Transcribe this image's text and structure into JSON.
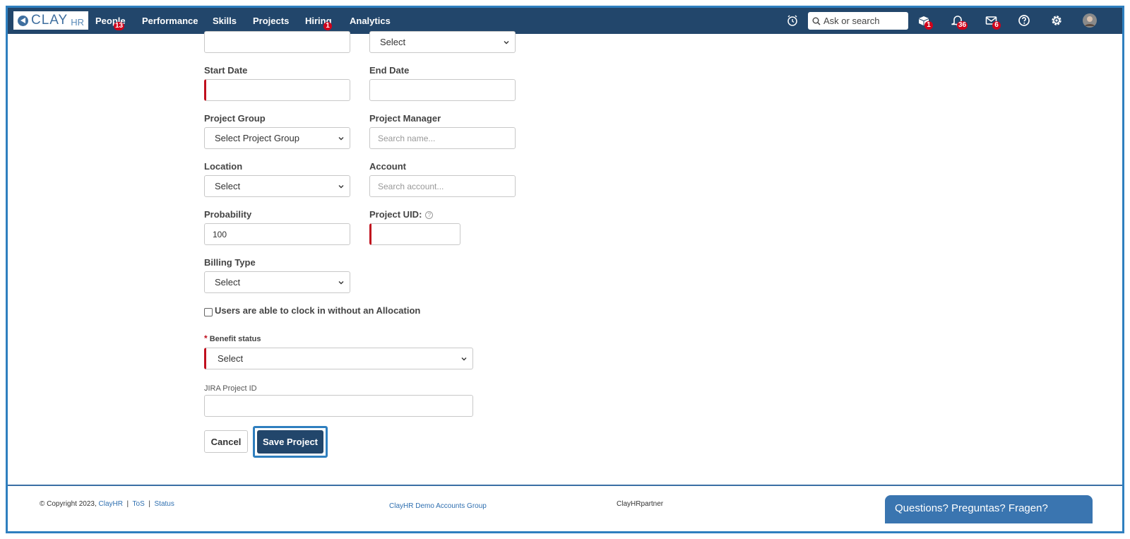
{
  "nav": {
    "logo": {
      "clay": "CLAY",
      "hr": "HR"
    },
    "items": [
      {
        "label": "People",
        "badge": "13"
      },
      {
        "label": "Performance"
      },
      {
        "label": "Skills"
      },
      {
        "label": "Projects",
        "active": true
      },
      {
        "label": "Hiring",
        "badge": "1"
      },
      {
        "label": "Analytics"
      }
    ],
    "search_placeholder": "Ask or search",
    "icons": [
      {
        "name": "alarm-clock-icon"
      },
      {
        "name": "box-icon",
        "badge": "1"
      },
      {
        "name": "bell-icon",
        "badge": "36"
      },
      {
        "name": "mail-icon",
        "badge": "6"
      },
      {
        "name": "help-icon"
      },
      {
        "name": "gear-icon"
      },
      {
        "name": "avatar"
      }
    ]
  },
  "form": {
    "top_left_value": "",
    "top_right_select": "Select",
    "start_date": {
      "label": "Start Date",
      "value": ""
    },
    "end_date": {
      "label": "End Date",
      "value": ""
    },
    "project_group": {
      "label": "Project Group",
      "value": "Select Project Group"
    },
    "project_manager": {
      "label": "Project Manager",
      "placeholder": "Search name..."
    },
    "location": {
      "label": "Location",
      "value": "Select"
    },
    "account": {
      "label": "Account",
      "placeholder": "Search account..."
    },
    "probability": {
      "label": "Probability",
      "value": "100"
    },
    "project_uid": {
      "label": "Project UID:",
      "value": ""
    },
    "billing_type": {
      "label": "Billing Type",
      "value": "Select"
    },
    "clock_in_checkbox": {
      "label": "Users are able to clock in without an Allocation",
      "checked": false
    },
    "benefit_status": {
      "required_mark": "*",
      "label": "Benefit status",
      "value": "Select"
    },
    "jira_project_id": {
      "label": "JIRA Project ID",
      "value": ""
    },
    "cancel_label": "Cancel",
    "save_label": "Save Project"
  },
  "footer": {
    "copyright": "© Copyright 2023,",
    "links": [
      "ClayHR",
      "ToS",
      "Status"
    ],
    "separator": "|",
    "group": "ClayHR Demo Accounts Group",
    "partner_prefix": "ClayHR",
    "partner_suffix": "partner",
    "chat": "Questions? Preguntas? Fragen?"
  },
  "colors": {
    "nav_bg": "#22466b",
    "accent": "#2f7fbf",
    "required": "#c0101e",
    "badge": "#d0021b"
  }
}
